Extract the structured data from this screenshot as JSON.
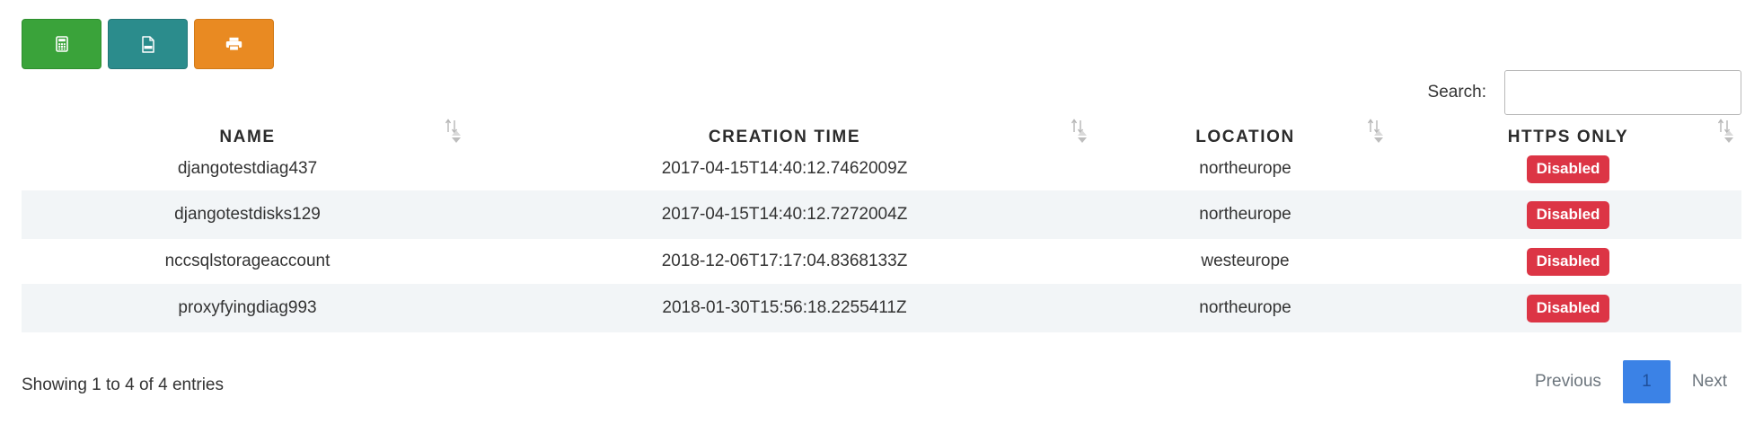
{
  "toolbar": {
    "buttons": [
      {
        "icon": "calculator-icon",
        "color": "#3aa33a"
      },
      {
        "icon": "csv-file-icon",
        "color": "#2b8c8c"
      },
      {
        "icon": "printer-icon",
        "color": "#e98a22"
      }
    ]
  },
  "search": {
    "label": "Search:",
    "value": "",
    "placeholder": ""
  },
  "table": {
    "columns": [
      "NAME",
      "CREATION TIME",
      "LOCATION",
      "HTTPS ONLY"
    ],
    "rows": [
      {
        "name": "djangotestdiag437",
        "creation_time": "2017-04-15T14:40:12.7462009Z",
        "location": "northeurope",
        "https_only": "Disabled"
      },
      {
        "name": "djangotestdisks129",
        "creation_time": "2017-04-15T14:40:12.7272004Z",
        "location": "northeurope",
        "https_only": "Disabled"
      },
      {
        "name": "nccsqlstorageaccount",
        "creation_time": "2018-12-06T17:17:04.8368133Z",
        "location": "westeurope",
        "https_only": "Disabled"
      },
      {
        "name": "proxyfyingdiag993",
        "creation_time": "2018-01-30T15:56:18.2255411Z",
        "location": "northeurope",
        "https_only": "Disabled"
      }
    ]
  },
  "footer": {
    "info": "Showing 1 to 4 of 4 entries",
    "previous": "Previous",
    "current_page": "1",
    "next": "Next"
  },
  "colors": {
    "badge_danger": "#dc3545",
    "stripe": "#f2f5f7",
    "pager_active": "#3b82e6"
  }
}
